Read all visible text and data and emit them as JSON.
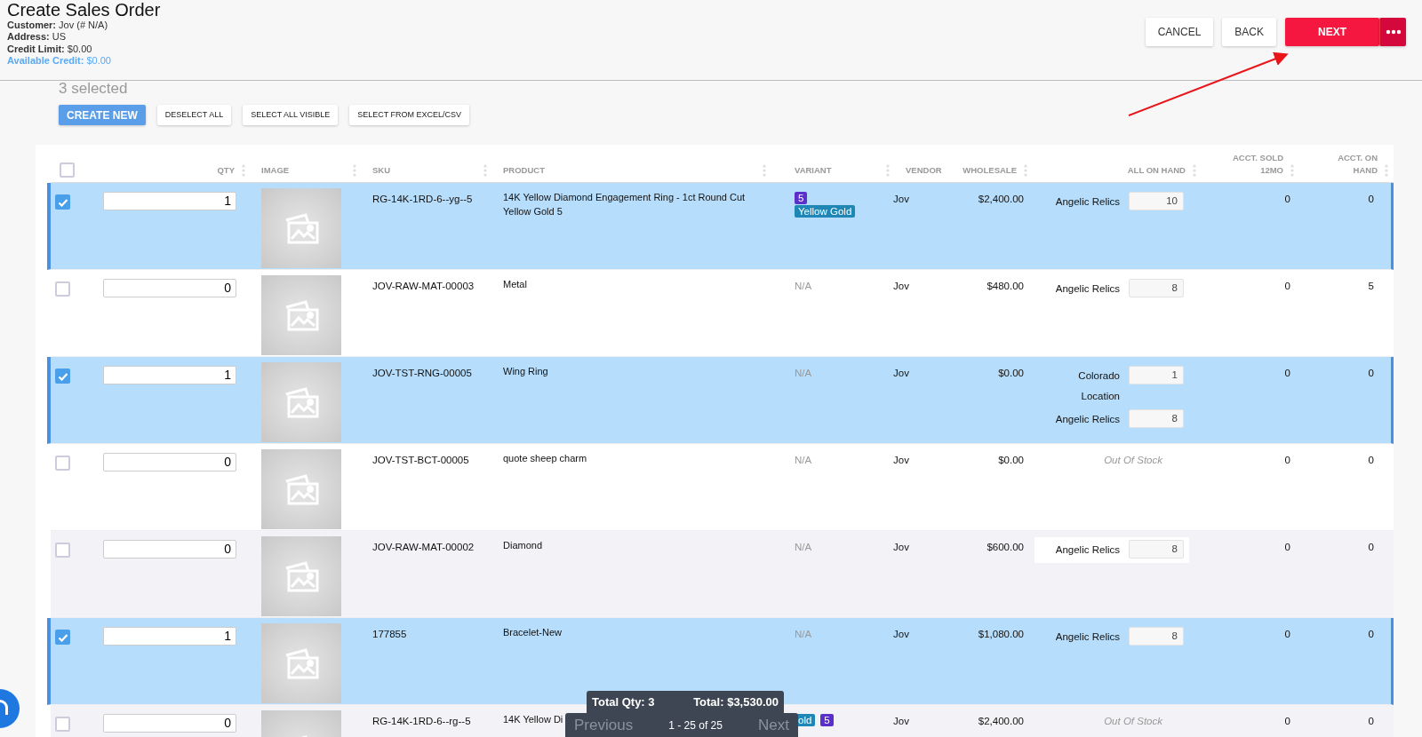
{
  "header": {
    "title": "Create Sales Order",
    "info": [
      {
        "text": "**Customer:** Jov (# N/A)",
        "kind": "plain"
      },
      {
        "text": "**Address:** US",
        "kind": "plain"
      },
      {
        "text": "**Credit Limit:** $0.00",
        "kind": "plain"
      },
      {
        "text": "**Available Credit:** $0.00",
        "kind": "accent"
      }
    ]
  },
  "actions": [
    {
      "label": "CANCEL",
      "kind": "default"
    },
    {
      "label": "BACK",
      "kind": "default"
    },
    {
      "label": "NEXT",
      "kind": "primary"
    },
    {
      "kind": "more"
    }
  ],
  "selection": {
    "count_text": "3 selected"
  },
  "toolbar": [
    {
      "label": "CREATE NEW",
      "kind": "primary"
    },
    {
      "label": "DESELECT ALL",
      "kind": "default"
    },
    {
      "label": "SELECT ALL VISIBLE",
      "kind": "default"
    },
    {
      "label": "SELECT FROM EXCEL/CSV",
      "kind": "default"
    }
  ],
  "table": {
    "header_checked": false,
    "columns": [
      "QTY",
      "IMAGE",
      "SKU",
      "PRODUCT",
      "VARIANT",
      "VENDOR",
      "WHOLESALE",
      "ALL ON HAND",
      "ACCT. SOLD 12MO",
      "ACCT. ON HAND"
    ],
    "rows": [
      {
        "selected": true,
        "qty": "1",
        "sku": "RG-14K-1RD-6--yg--5",
        "product": "14K Yellow Diamond Engagement Ring - 1ct Round Cut Yellow Gold 5",
        "variant": [
          {
            "text": "5",
            "color": "#5b2fc9"
          },
          {
            "text": "Yellow Gold",
            "color": "#1e87b5"
          }
        ],
        "vendor": "Jov",
        "wholesale": "$2,400.00",
        "stock": [
          {
            "location": "Angelic Relics",
            "qty": "10"
          }
        ],
        "acct_sold_12mo": "0",
        "acct_on_hand": "0"
      },
      {
        "selected": false,
        "qty": "0",
        "sku": "JOV-RAW-MAT-00003",
        "product": "Metal",
        "variant_text": "N/A",
        "vendor": "Jov",
        "wholesale": "$480.00",
        "stock": [
          {
            "location": "Angelic Relics",
            "qty": "8"
          }
        ],
        "acct_sold_12mo": "0",
        "acct_on_hand": "5"
      },
      {
        "selected": true,
        "qty": "1",
        "sku": "JOV-TST-RNG-00005",
        "product": "Wing Ring",
        "variant_text": "N/A",
        "vendor": "Jov",
        "wholesale": "$0.00",
        "stock": [
          {
            "location": "Colorado Location",
            "qty": "1"
          },
          {
            "location": "Angelic Relics",
            "qty": "8"
          }
        ],
        "acct_sold_12mo": "0",
        "acct_on_hand": "0"
      },
      {
        "selected": false,
        "qty": "0",
        "sku": "JOV-TST-BCT-00005",
        "product": "quote sheep charm",
        "variant_text": "N/A",
        "vendor": "Jov",
        "wholesale": "$0.00",
        "stock_note": "Out Of Stock",
        "acct_sold_12mo": "0",
        "acct_on_hand": "0"
      },
      {
        "selected": false,
        "qty": "0",
        "sku": "JOV-RAW-MAT-00002",
        "product": "Diamond",
        "variant_text": "N/A",
        "vendor": "Jov",
        "wholesale": "$600.00",
        "stock": [
          {
            "location": "Angelic Relics",
            "qty": "8"
          }
        ],
        "acct_sold_12mo": "0",
        "acct_on_hand": "0"
      },
      {
        "selected": true,
        "qty": "1",
        "sku": "177855",
        "product": "Bracelet-New",
        "variant_text": "N/A",
        "vendor": "Jov",
        "wholesale": "$1,080.00",
        "stock": [
          {
            "location": "Angelic Relics",
            "qty": "8"
          }
        ],
        "acct_sold_12mo": "0",
        "acct_on_hand": "0"
      },
      {
        "selected": false,
        "qty": "0",
        "sku": "RG-14K-1RD-6--rg--5",
        "product": "14K Yellow Di",
        "variant": [
          {
            "text": "old",
            "color": "#1e87b5"
          },
          {
            "text": "5",
            "color": "#5b2fc9"
          }
        ],
        "vendor": "Jov",
        "wholesale": "$2,400.00",
        "stock_note": "Out Of Stock",
        "acct_sold_12mo": "0",
        "acct_on_hand": "0"
      }
    ]
  },
  "footer": {
    "total_qty": "Total Qty: 3",
    "total": "Total: $3,530.00",
    "pager": {
      "previous": {
        "label": "Previous",
        "disabled": true
      },
      "range": "1 - 25 of 25",
      "next": {
        "label": "Next",
        "disabled": true
      }
    }
  }
}
